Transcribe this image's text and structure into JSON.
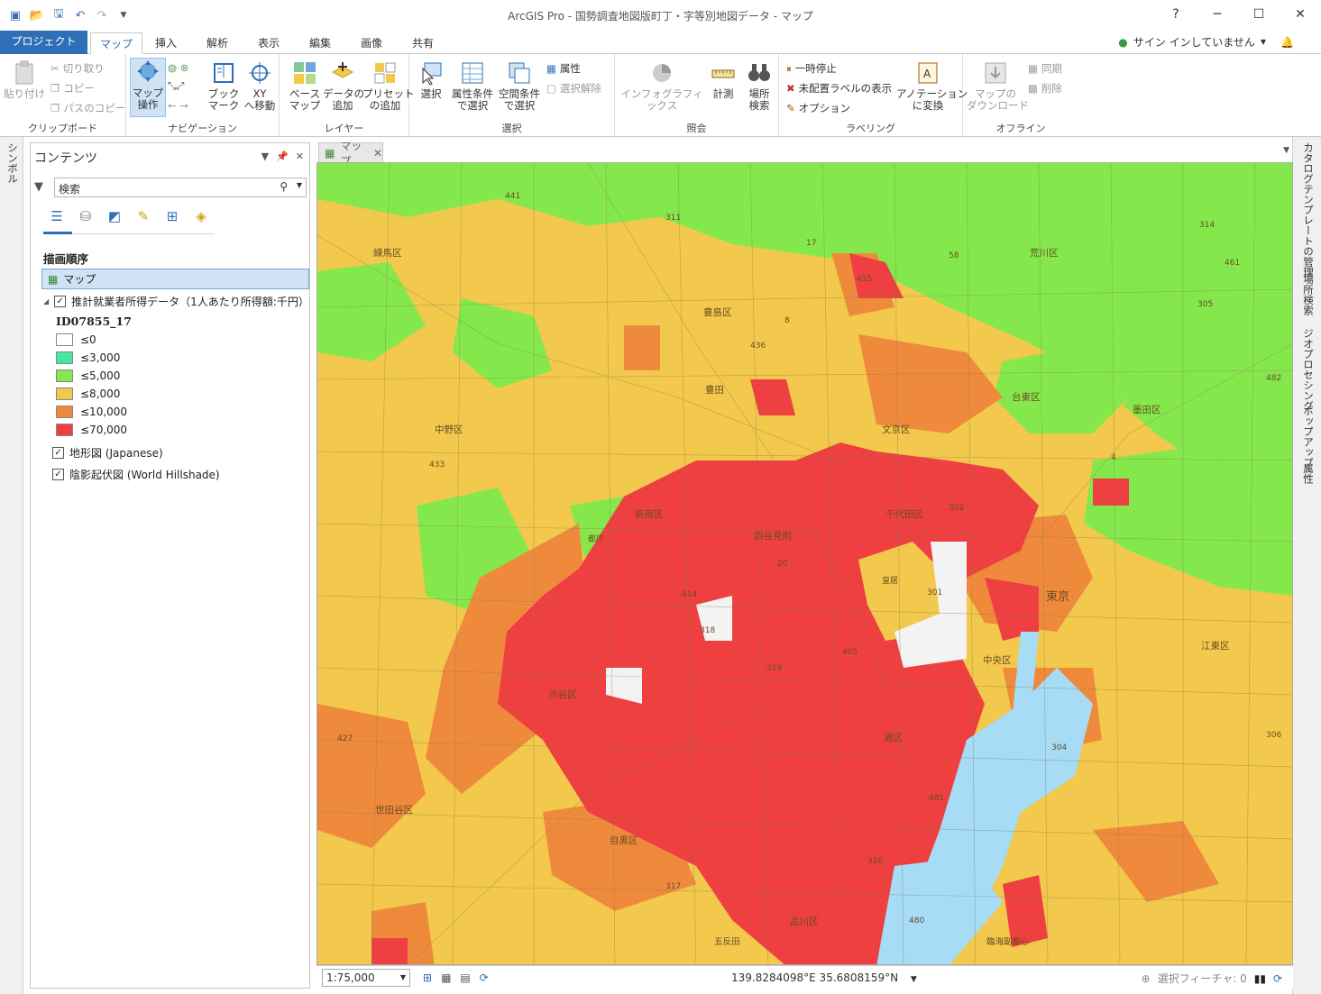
{
  "window": {
    "title": "ArcGIS Pro - 国勢調査地図版町丁・字等別地図データ - マップ",
    "help": "?",
    "minimize": "─",
    "maximize": "☐",
    "close": "✕"
  },
  "tabs": {
    "project": "プロジェクト",
    "items": [
      "マップ",
      "挿入",
      "解析",
      "表示",
      "編集",
      "画像",
      "共有"
    ],
    "signin": "サイン インしていません"
  },
  "ribbon": {
    "clipboard": {
      "paste": "貼り付け",
      "cut": "切り取り",
      "copy": "コピー",
      "copy_path": "パスのコピー",
      "label": "クリップボード"
    },
    "navigation": {
      "explore": "マップ\n操作",
      "bookmarks": "ブック\nマーク",
      "goto_xy": "XY\nへ移動",
      "label": "ナビゲーション"
    },
    "layer": {
      "basemap": "ベース\nマップ",
      "add_data": "データの\n追加",
      "add_preset": "プリセット\nの追加",
      "label": "レイヤー"
    },
    "selection": {
      "select": "選択",
      "by_attr": "属性条件\nで選択",
      "by_loc": "空間条件\nで選択",
      "attributes": "属性",
      "clear": "選択解除",
      "label": "選択"
    },
    "inquiry": {
      "infographics": "インフォグラフィックス",
      "measure": "計測",
      "locate": "場所\n検索",
      "label": "照会"
    },
    "labeling": {
      "pause": "一時停止",
      "unplaced": "未配置ラベルの表示",
      "options": "オプション",
      "convert": "アノテーション\nに変換",
      "label": "ラベリング"
    },
    "offline": {
      "download": "マップの\nダウンロード",
      "sync": "同期",
      "remove": "削除",
      "label": "オフライン"
    }
  },
  "left_strip": {
    "symbology": "シンボル"
  },
  "right_strip": [
    "カタログ",
    "テンプレートの管理",
    "場所検索",
    "ジオプロセシング",
    "ポップアップ",
    "属性"
  ],
  "contents": {
    "title": "コンテンツ",
    "search_placeholder": "検索",
    "drawing_order": "描画順序",
    "map_name": "マップ",
    "layer_name": "推計就業者所得データ（1人あたり所得額:千円）",
    "field": "ID07855_17",
    "legend": [
      {
        "label": "≤0",
        "color": "#ffffff"
      },
      {
        "label": "≤3,000",
        "color": "#46e8a0"
      },
      {
        "label": "≤5,000",
        "color": "#84e84c"
      },
      {
        "label": "≤8,000",
        "color": "#f2c94c"
      },
      {
        "label": "≤10,000",
        "color": "#ef8a3c"
      },
      {
        "label": "≤70,000",
        "color": "#ee4040"
      }
    ],
    "basemap1": "地形図 (Japanese)",
    "basemap2": "陰影起伏図 (World Hillshade)"
  },
  "map_tab": "マップ",
  "map_labels": [
    "練馬区",
    "豊島区",
    "荒川区",
    "台東区",
    "墨田区",
    "中野区",
    "文京区",
    "新宿区",
    "千代田区",
    "東京",
    "中央区",
    "渋谷区",
    "港区",
    "江東区",
    "世田谷区",
    "目黒区",
    "品川区",
    "都庁",
    "皇居",
    "四谷見附",
    "豊田",
    "臨海副都心",
    "五反田"
  ],
  "route_labels": [
    "441",
    "311",
    "17",
    "455",
    "58",
    "314",
    "461",
    "305",
    "436",
    "8",
    "4",
    "482",
    "302",
    "301",
    "20",
    "414",
    "319",
    "405",
    "306",
    "304",
    "318",
    "427",
    "317",
    "316",
    "480",
    "481",
    "433"
  ],
  "statusbar": {
    "scale": "1:75,000",
    "coordinates": "139.8284098°E 35.6808159°N",
    "selected": "選択フィーチャ: 0"
  },
  "colors": {
    "accent": "#2e6fb8",
    "red": "#ee4040",
    "orange": "#ef8a3c",
    "yellow": "#f2c94c",
    "green": "#84e84c",
    "teal": "#46e8a0",
    "water": "#a6dcf5"
  }
}
